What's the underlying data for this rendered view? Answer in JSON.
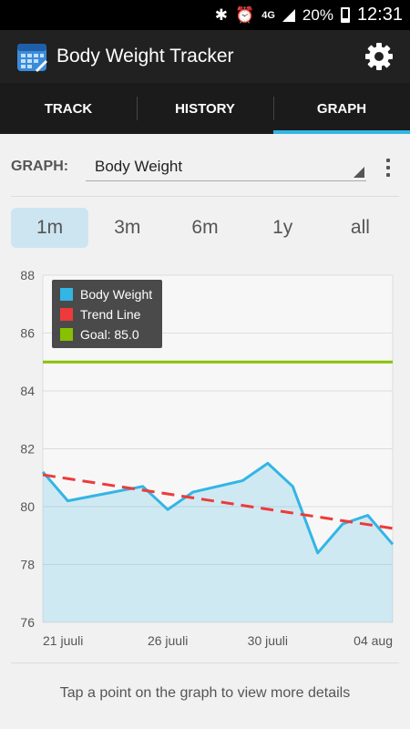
{
  "status_bar": {
    "time": "12:31",
    "battery": "20%",
    "network": "4G"
  },
  "app": {
    "title": "Body Weight Tracker"
  },
  "tabs": [
    {
      "label": "TRACK"
    },
    {
      "label": "HISTORY"
    },
    {
      "label": "GRAPH",
      "active": true
    }
  ],
  "graph_selector": {
    "label": "GRAPH:",
    "value": "Body Weight"
  },
  "ranges": [
    {
      "label": "1m",
      "active": true
    },
    {
      "label": "3m"
    },
    {
      "label": "6m"
    },
    {
      "label": "1y"
    },
    {
      "label": "all"
    }
  ],
  "colors": {
    "accent": "#33b5e5",
    "weight": "#33b5e5",
    "trend": "#ee3a3a",
    "goal": "#88c100"
  },
  "chart_data": {
    "type": "area",
    "x": [
      "21 juuli",
      "22 juuli",
      "25 juuli",
      "26 juuli",
      "27 juuli",
      "29 juuli",
      "30 juuli",
      "31 juuli",
      "01 aug",
      "02 aug",
      "03 aug",
      "04 aug"
    ],
    "x_labels": [
      "21 juuli",
      "26 juuli",
      "30 juuli",
      "04 aug"
    ],
    "series": [
      {
        "name": "Body Weight",
        "values": [
          81.2,
          80.2,
          80.7,
          79.9,
          80.5,
          80.9,
          81.5,
          80.7,
          78.4,
          79.4,
          79.7,
          78.7
        ]
      },
      {
        "name": "Trend Line",
        "values": [
          81.1,
          79.25
        ]
      },
      {
        "name": "Goal: 85.0",
        "values": [
          85.0
        ]
      }
    ],
    "yticks": [
      76,
      78,
      80,
      82,
      84,
      86,
      88
    ],
    "ylim": [
      76,
      88
    ],
    "grid": true,
    "legend": "top-left"
  },
  "footer": {
    "hint": "Tap a point on the graph to view more details"
  }
}
